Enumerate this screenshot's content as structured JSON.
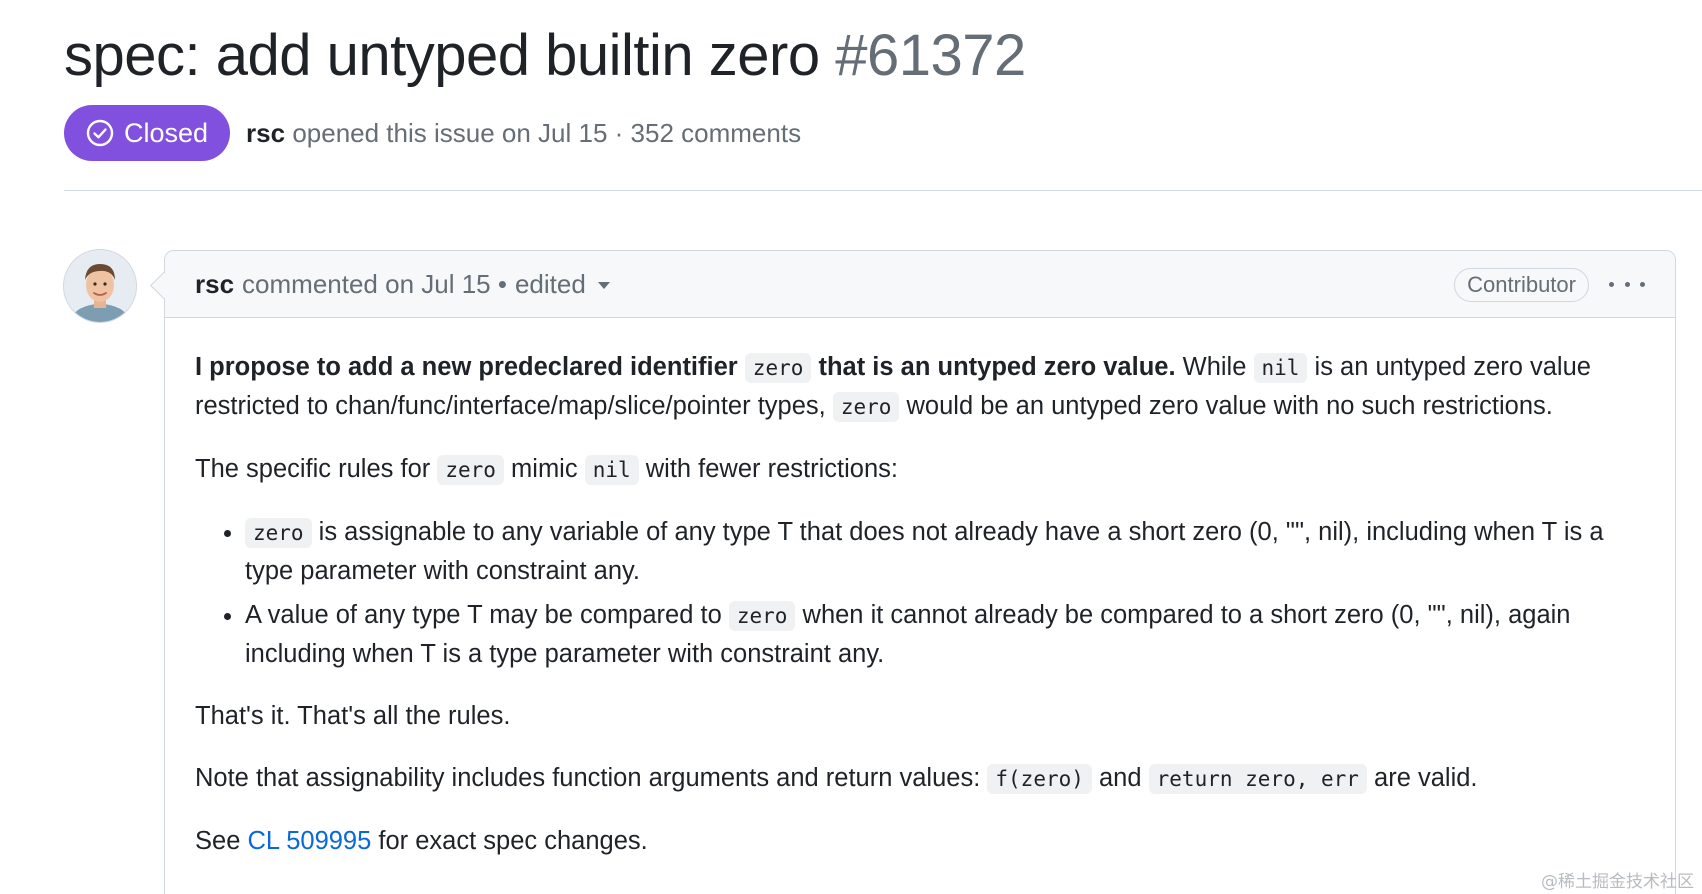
{
  "issue": {
    "title": "spec: add untyped builtin zero",
    "number": "#61372",
    "state": "Closed",
    "state_color": "#8250df",
    "author": "rsc",
    "opened_text": "opened this issue on Jul 15 · 352 comments"
  },
  "comment": {
    "author": "rsc",
    "meta": "commented on Jul 15 •",
    "edited": "edited",
    "role_badge": "Contributor",
    "body": {
      "p1": {
        "bold_a": "I propose to add a new predeclared identifier",
        "code_a": "zero",
        "bold_b": "that is an untyped zero value.",
        "text_a": "While",
        "code_b": "nil",
        "text_b": "is an untyped zero value restricted to chan/func/interface/map/slice/pointer types,",
        "code_c": "zero",
        "text_c": "would be an untyped zero value with no such restrictions."
      },
      "p2": {
        "text_a": "The specific rules for",
        "code_a": "zero",
        "text_b": "mimic",
        "code_b": "nil",
        "text_c": "with fewer restrictions:"
      },
      "bullets": [
        {
          "code_a": "zero",
          "text_a": "is assignable to any variable of any type T that does not already have a short zero (0, \"\", nil), including when T is a type parameter with constraint any."
        },
        {
          "text_a": "A value of any type T may be compared to",
          "code_a": "zero",
          "text_b": "when it cannot already be compared to a short zero (0, \"\", nil), again including when T is a type parameter with constraint any."
        }
      ],
      "p3": "That's it. That's all the rules.",
      "p4": {
        "text_a": "Note that assignability includes function arguments and return values:",
        "code_a": "f(zero)",
        "text_b": "and",
        "code_b": "return zero, err",
        "text_c": "are valid."
      },
      "p5": {
        "text_a": "See",
        "link": "CL 509995",
        "text_b": "for exact spec changes."
      }
    }
  },
  "watermark": "@稀土掘金技术社区",
  "icons": {
    "state": "check-circle-icon",
    "menu": "kebab-horizontal-icon",
    "caret": "caret-down-icon"
  }
}
